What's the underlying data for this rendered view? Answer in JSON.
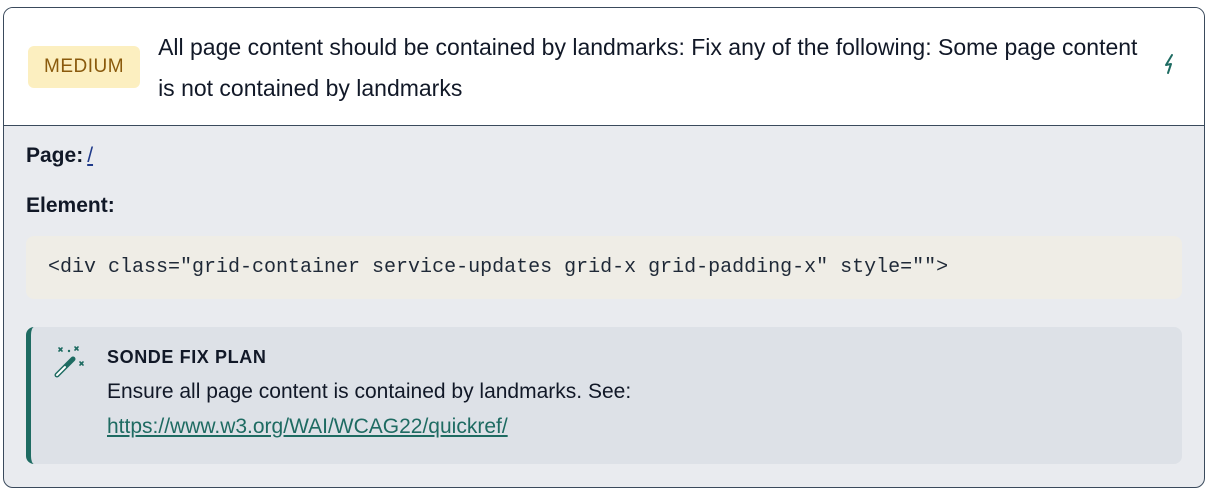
{
  "issue": {
    "severity": "MEDIUM",
    "title": "All page content should be contained by landmarks: Fix any of the following: Some page content is not contained by landmarks"
  },
  "details": {
    "page_label": "Page:",
    "page_link": "/",
    "element_label": "Element:",
    "element_code": "<div class=\"grid-container service-updates grid-x grid-padding-x\" style=\"\">"
  },
  "fix_plan": {
    "heading": "SONDE FIX PLAN",
    "description": "Ensure all page content is contained by landmarks. See:",
    "link": "https://www.w3.org/WAI/WCAG22/quickref/"
  },
  "icons": {
    "header_action": "bolt-icon",
    "fix_plan": "magic-wand-icon"
  },
  "colors": {
    "badge_bg": "#fcefc0",
    "badge_text": "#8a5a0c",
    "accent": "#1e6b62",
    "border": "#3a4a5c"
  }
}
